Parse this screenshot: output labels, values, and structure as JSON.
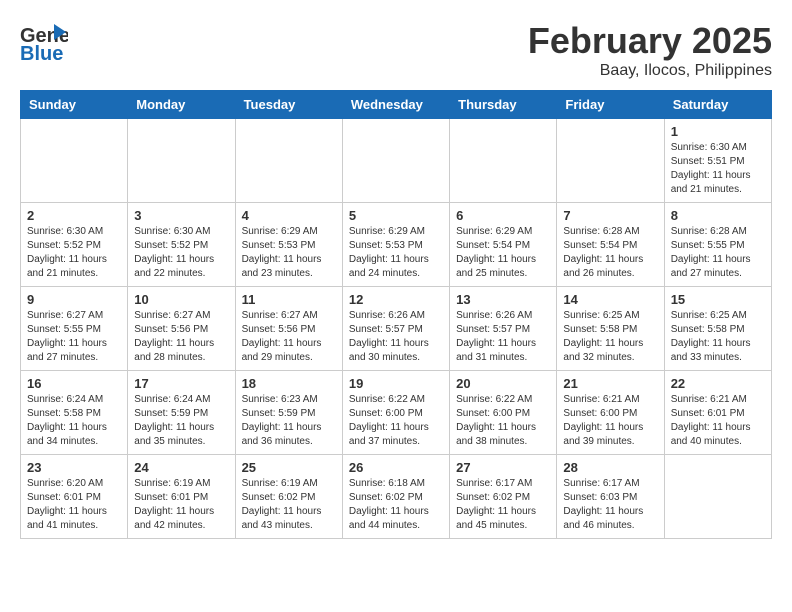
{
  "header": {
    "logo_general": "General",
    "logo_blue": "Blue",
    "title": "February 2025",
    "subtitle": "Baay, Ilocos, Philippines"
  },
  "weekdays": [
    "Sunday",
    "Monday",
    "Tuesday",
    "Wednesday",
    "Thursday",
    "Friday",
    "Saturday"
  ],
  "weeks": [
    [
      {
        "day": "",
        "info": ""
      },
      {
        "day": "",
        "info": ""
      },
      {
        "day": "",
        "info": ""
      },
      {
        "day": "",
        "info": ""
      },
      {
        "day": "",
        "info": ""
      },
      {
        "day": "",
        "info": ""
      },
      {
        "day": "1",
        "info": "Sunrise: 6:30 AM\nSunset: 5:51 PM\nDaylight: 11 hours and 21 minutes."
      }
    ],
    [
      {
        "day": "2",
        "info": "Sunrise: 6:30 AM\nSunset: 5:52 PM\nDaylight: 11 hours and 21 minutes."
      },
      {
        "day": "3",
        "info": "Sunrise: 6:30 AM\nSunset: 5:52 PM\nDaylight: 11 hours and 22 minutes."
      },
      {
        "day": "4",
        "info": "Sunrise: 6:29 AM\nSunset: 5:53 PM\nDaylight: 11 hours and 23 minutes."
      },
      {
        "day": "5",
        "info": "Sunrise: 6:29 AM\nSunset: 5:53 PM\nDaylight: 11 hours and 24 minutes."
      },
      {
        "day": "6",
        "info": "Sunrise: 6:29 AM\nSunset: 5:54 PM\nDaylight: 11 hours and 25 minutes."
      },
      {
        "day": "7",
        "info": "Sunrise: 6:28 AM\nSunset: 5:54 PM\nDaylight: 11 hours and 26 minutes."
      },
      {
        "day": "8",
        "info": "Sunrise: 6:28 AM\nSunset: 5:55 PM\nDaylight: 11 hours and 27 minutes."
      }
    ],
    [
      {
        "day": "9",
        "info": "Sunrise: 6:27 AM\nSunset: 5:55 PM\nDaylight: 11 hours and 27 minutes."
      },
      {
        "day": "10",
        "info": "Sunrise: 6:27 AM\nSunset: 5:56 PM\nDaylight: 11 hours and 28 minutes."
      },
      {
        "day": "11",
        "info": "Sunrise: 6:27 AM\nSunset: 5:56 PM\nDaylight: 11 hours and 29 minutes."
      },
      {
        "day": "12",
        "info": "Sunrise: 6:26 AM\nSunset: 5:57 PM\nDaylight: 11 hours and 30 minutes."
      },
      {
        "day": "13",
        "info": "Sunrise: 6:26 AM\nSunset: 5:57 PM\nDaylight: 11 hours and 31 minutes."
      },
      {
        "day": "14",
        "info": "Sunrise: 6:25 AM\nSunset: 5:58 PM\nDaylight: 11 hours and 32 minutes."
      },
      {
        "day": "15",
        "info": "Sunrise: 6:25 AM\nSunset: 5:58 PM\nDaylight: 11 hours and 33 minutes."
      }
    ],
    [
      {
        "day": "16",
        "info": "Sunrise: 6:24 AM\nSunset: 5:58 PM\nDaylight: 11 hours and 34 minutes."
      },
      {
        "day": "17",
        "info": "Sunrise: 6:24 AM\nSunset: 5:59 PM\nDaylight: 11 hours and 35 minutes."
      },
      {
        "day": "18",
        "info": "Sunrise: 6:23 AM\nSunset: 5:59 PM\nDaylight: 11 hours and 36 minutes."
      },
      {
        "day": "19",
        "info": "Sunrise: 6:22 AM\nSunset: 6:00 PM\nDaylight: 11 hours and 37 minutes."
      },
      {
        "day": "20",
        "info": "Sunrise: 6:22 AM\nSunset: 6:00 PM\nDaylight: 11 hours and 38 minutes."
      },
      {
        "day": "21",
        "info": "Sunrise: 6:21 AM\nSunset: 6:00 PM\nDaylight: 11 hours and 39 minutes."
      },
      {
        "day": "22",
        "info": "Sunrise: 6:21 AM\nSunset: 6:01 PM\nDaylight: 11 hours and 40 minutes."
      }
    ],
    [
      {
        "day": "23",
        "info": "Sunrise: 6:20 AM\nSunset: 6:01 PM\nDaylight: 11 hours and 41 minutes."
      },
      {
        "day": "24",
        "info": "Sunrise: 6:19 AM\nSunset: 6:01 PM\nDaylight: 11 hours and 42 minutes."
      },
      {
        "day": "25",
        "info": "Sunrise: 6:19 AM\nSunset: 6:02 PM\nDaylight: 11 hours and 43 minutes."
      },
      {
        "day": "26",
        "info": "Sunrise: 6:18 AM\nSunset: 6:02 PM\nDaylight: 11 hours and 44 minutes."
      },
      {
        "day": "27",
        "info": "Sunrise: 6:17 AM\nSunset: 6:02 PM\nDaylight: 11 hours and 45 minutes."
      },
      {
        "day": "28",
        "info": "Sunrise: 6:17 AM\nSunset: 6:03 PM\nDaylight: 11 hours and 46 minutes."
      },
      {
        "day": "",
        "info": ""
      }
    ]
  ]
}
